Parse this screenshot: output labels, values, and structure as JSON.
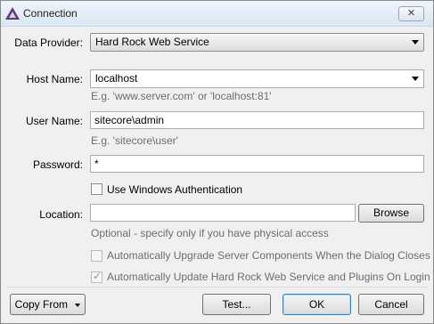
{
  "window": {
    "title": "Connection",
    "close_glyph": "✕",
    "icon": "sitecore-triangle-icon"
  },
  "data_provider": {
    "label": "Data Provider:",
    "value": "Hard Rock Web Service"
  },
  "host_name": {
    "label": "Host Name:",
    "value": "localhost",
    "hint": "E.g. 'www.server.com' or 'localhost:81'"
  },
  "user_name": {
    "label": "User Name:",
    "value": "sitecore\\admin",
    "hint": "E.g. 'sitecore\\user'"
  },
  "password": {
    "label": "Password:",
    "value": "*"
  },
  "windows_auth": {
    "label": "Use Windows Authentication",
    "checked": false
  },
  "location": {
    "label": "Location:",
    "value": "",
    "browse_label": "Browse",
    "hint": "Optional - specify only if you have physical access"
  },
  "upgrade_server": {
    "label": "Automatically Upgrade Server Components When the Dialog Closes",
    "checked": false,
    "enabled": false
  },
  "auto_update": {
    "label": "Automatically Update Hard Rock Web Service and Plugins On Login",
    "checked": true,
    "enabled": false
  },
  "footer": {
    "copy_from_label": "Copy From",
    "test_label": "Test...",
    "ok_label": "OK",
    "cancel_label": "Cancel"
  }
}
